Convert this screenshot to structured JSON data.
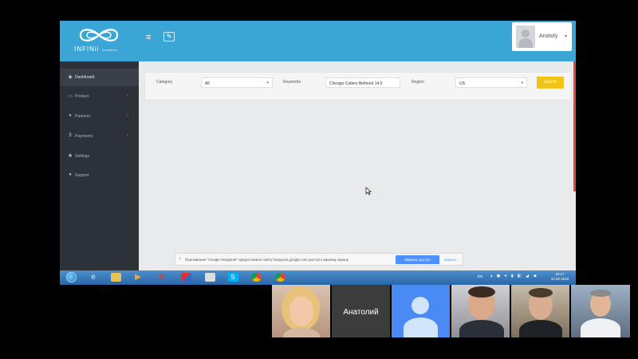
{
  "app": {
    "logo_text": "INFINii",
    "logo_sub": "Commerce",
    "user_name": "Anatoly"
  },
  "sidebar": {
    "items": [
      {
        "label": "Dashboard",
        "icon": "dashboard-icon",
        "active": true,
        "has_children": false
      },
      {
        "label": "Product",
        "icon": "monitor-icon",
        "active": false,
        "has_children": true
      },
      {
        "label": "Partners",
        "icon": "user-icon",
        "active": false,
        "has_children": true
      },
      {
        "label": "Payments",
        "icon": "dollar-icon",
        "active": false,
        "has_children": true
      },
      {
        "label": "Settings",
        "icon": "gear-icon",
        "active": false,
        "has_children": false
      },
      {
        "label": "Support",
        "icon": "help-icon",
        "active": false,
        "has_children": false
      }
    ]
  },
  "filters": {
    "category_label": "Category",
    "category_value": "All",
    "keywords_label": "Keywords",
    "keywords_value": "Chicago Cutlery Belmont 14.5",
    "region_label": "Region",
    "region_value": "US",
    "search_label": "Search"
  },
  "notice": {
    "text": "Приложение \"Google Hangouts\" предоставило сайту hangouts.google.com доступ к вашему экрану",
    "share_label": "Закрыть доступ",
    "hide_label": "Скрыть"
  },
  "taskbar": {
    "language": "EN",
    "time": "20:17",
    "date": "10.02.2016",
    "apps": [
      "windows-start-icon",
      "internet-explorer-icon",
      "file-explorer-icon",
      "media-player-icon",
      "opera-icon",
      "app-icon",
      "notepad-icon",
      "skype-icon",
      "chrome-icon",
      "chrome-icon"
    ]
  },
  "call": {
    "participants": [
      {
        "name": "",
        "type": "video"
      },
      {
        "name": "Анатолий",
        "type": "label"
      },
      {
        "name": "",
        "type": "avatar"
      },
      {
        "name": "",
        "type": "video"
      },
      {
        "name": "",
        "type": "video"
      },
      {
        "name": "",
        "type": "video"
      }
    ]
  },
  "colors": {
    "header": "#3aa6d6",
    "sidebar": "#2d3238",
    "search_button": "#f0c419",
    "hangouts_blue": "#4a8af4"
  }
}
